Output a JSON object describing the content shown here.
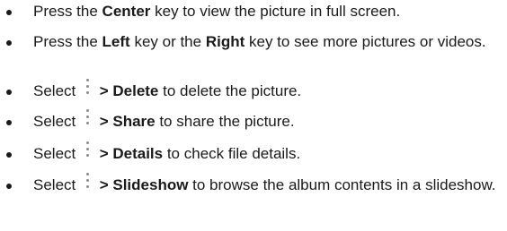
{
  "items": [
    {
      "pre": "Press the ",
      "bold": "Center",
      "post": " key to view the picture in full screen."
    },
    {
      "pre": "Press the ",
      "bold": "Left",
      "mid": " key or the ",
      "bold2": "Right",
      "post": " key to see more pictures or videos."
    },
    {
      "pre": "Select ",
      "icon": "more-vertical-icon",
      "arrow": " > ",
      "bold": "Delete",
      "post": " to delete the picture."
    },
    {
      "pre": "Select ",
      "icon": "more-vertical-icon",
      "arrow": " > ",
      "bold": "Share",
      "post": " to share the picture."
    },
    {
      "pre": "Select ",
      "icon": "more-vertical-icon",
      "arrow": " > ",
      "bold": "Details",
      "post": " to check file details."
    },
    {
      "pre": "Select ",
      "icon": "more-vertical-icon",
      "arrow": " > ",
      "bold": "Slideshow",
      "post": " to browse the album contents in a slideshow."
    }
  ]
}
